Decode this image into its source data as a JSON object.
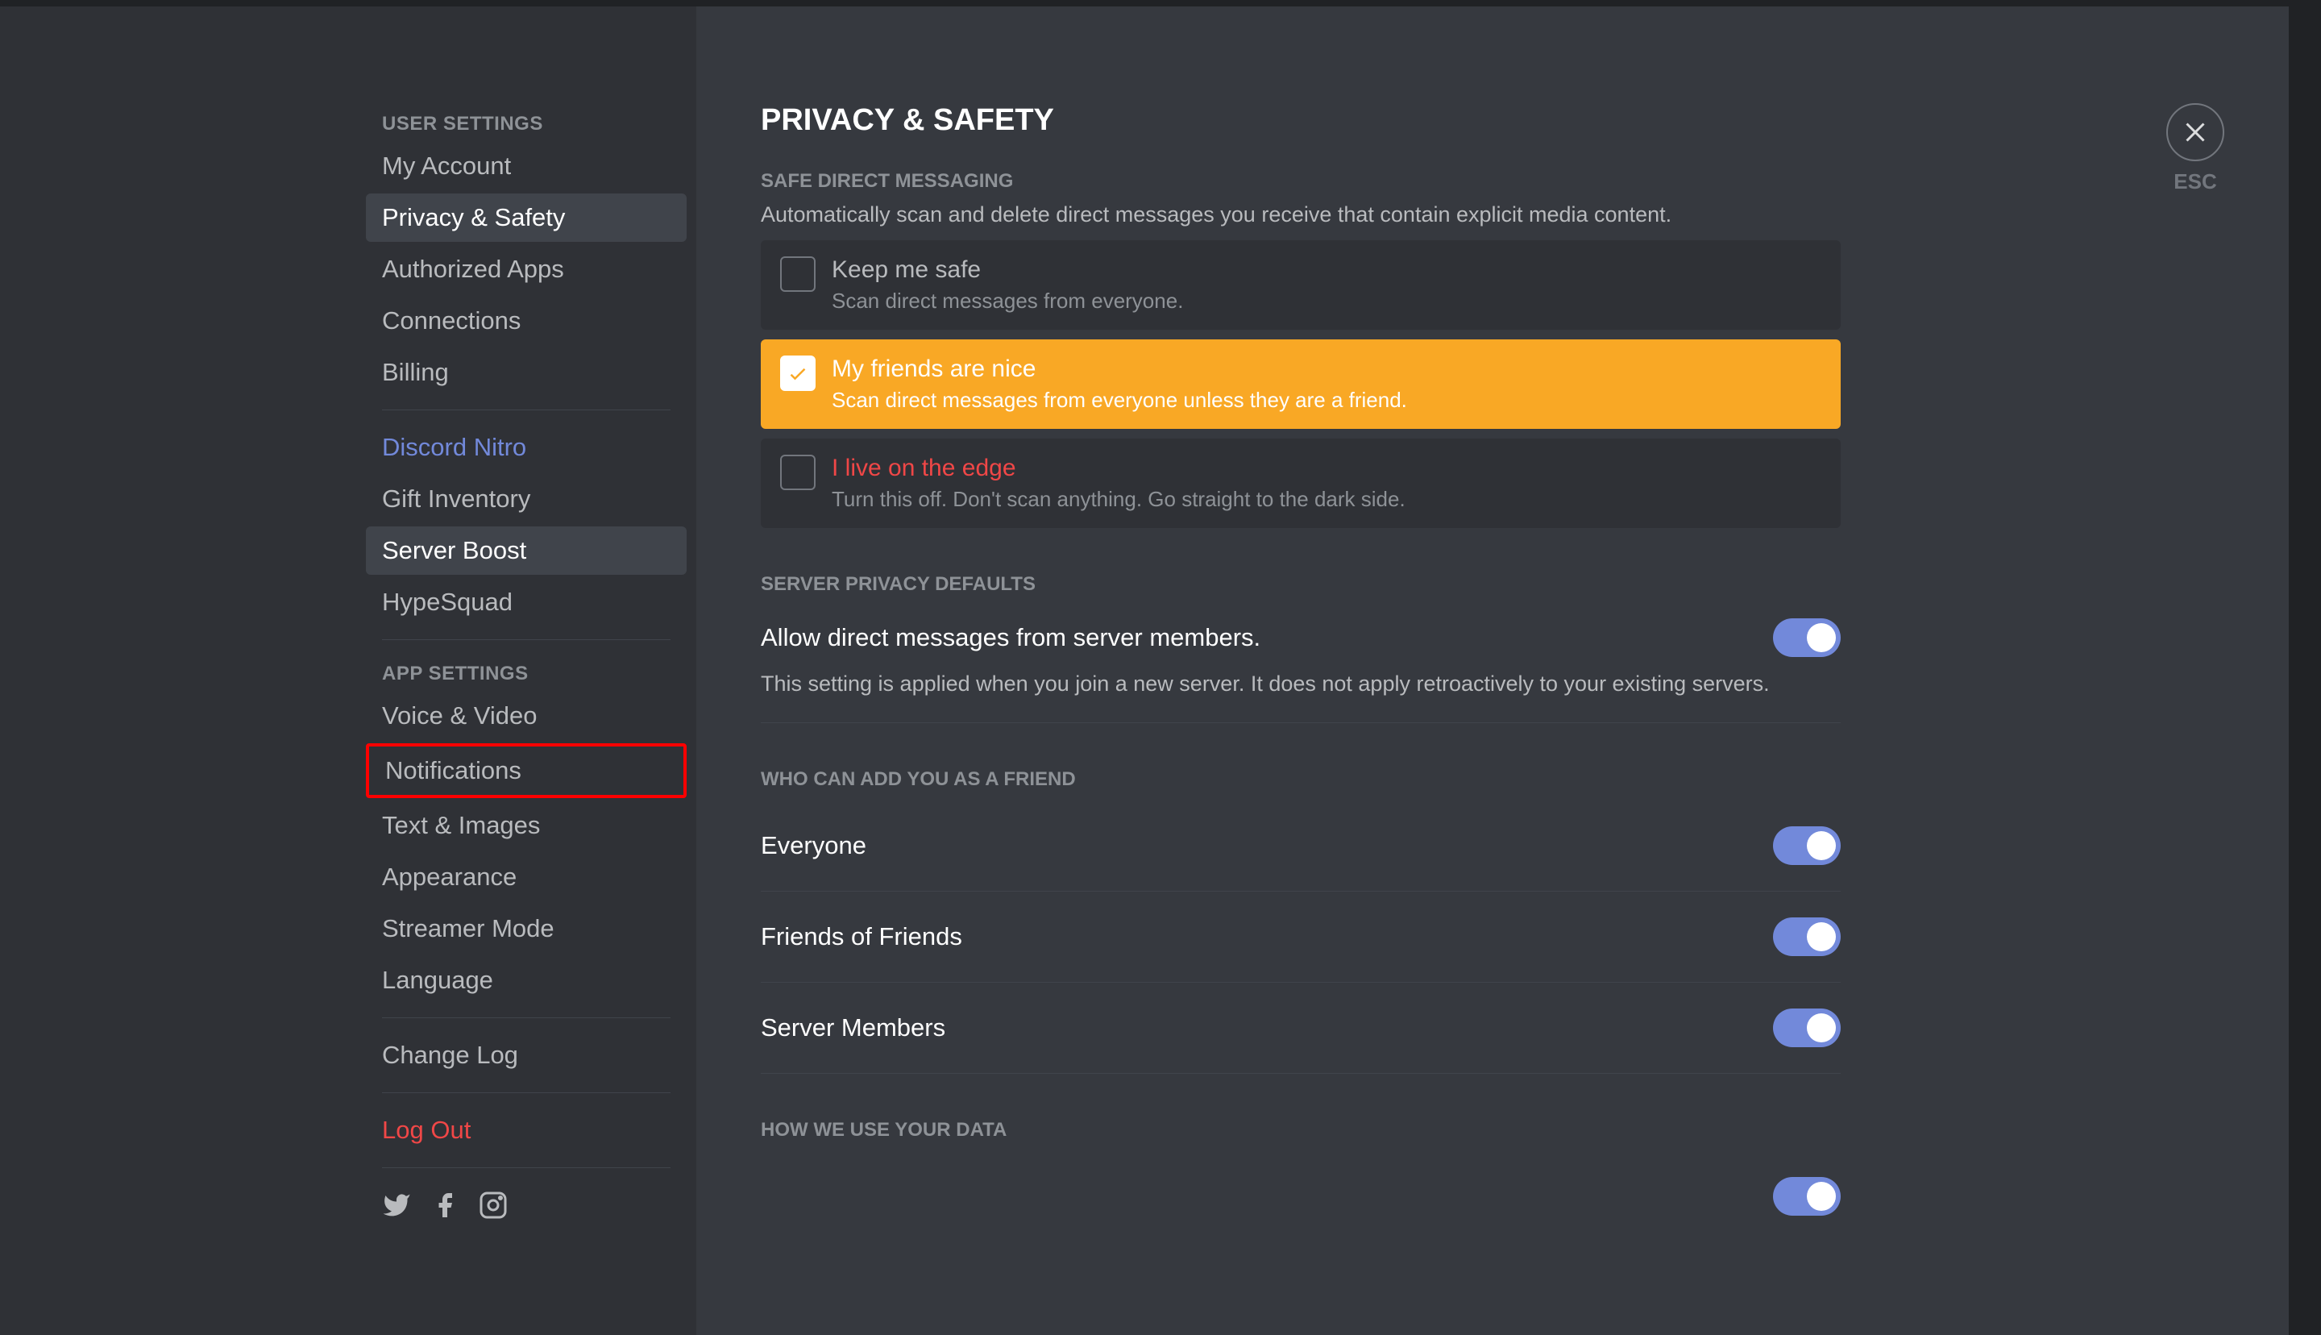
{
  "sidebar": {
    "user_settings_header": "User Settings",
    "items_user": [
      {
        "label": "My Account"
      },
      {
        "label": "Privacy & Safety",
        "selected": true
      },
      {
        "label": "Authorized Apps"
      },
      {
        "label": "Connections"
      },
      {
        "label": "Billing"
      }
    ],
    "items_nitro": [
      {
        "label": "Discord Nitro",
        "nitro": true
      },
      {
        "label": "Gift Inventory"
      },
      {
        "label": "Server Boost",
        "boost": true
      },
      {
        "label": "HypeSquad"
      }
    ],
    "app_settings_header": "App Settings",
    "items_app": [
      {
        "label": "Voice & Video"
      },
      {
        "label": "Notifications",
        "highlighted": true
      },
      {
        "label": "Text & Images"
      },
      {
        "label": "Appearance"
      },
      {
        "label": "Streamer Mode"
      },
      {
        "label": "Language"
      }
    ],
    "change_log": "Change Log",
    "log_out": "Log Out"
  },
  "close": {
    "esc": "ESC"
  },
  "page": {
    "title": "Privacy & Safety",
    "safe_dm_header": "Safe Direct Messaging",
    "safe_dm_desc": "Automatically scan and delete direct messages you receive that contain explicit media content.",
    "radio_options": [
      {
        "title": "Keep me safe",
        "desc": "Scan direct messages from everyone."
      },
      {
        "title": "My friends are nice",
        "desc": "Scan direct messages from everyone unless they are a friend.",
        "selected": true
      },
      {
        "title": "I live on the edge",
        "desc": "Turn this off. Don't scan anything. Go straight to the dark side.",
        "danger": true
      }
    ],
    "server_privacy_header": "Server Privacy Defaults",
    "allow_dm_label": "Allow direct messages from server members.",
    "allow_dm_desc": "This setting is applied when you join a new server. It does not apply retroactively to your existing servers.",
    "friend_add_header": "Who Can Add You As A Friend",
    "friend_options": [
      {
        "label": "Everyone",
        "on": true
      },
      {
        "label": "Friends of Friends",
        "on": true
      },
      {
        "label": "Server Members",
        "on": true
      }
    ],
    "data_header": "How We Use Your Data"
  }
}
